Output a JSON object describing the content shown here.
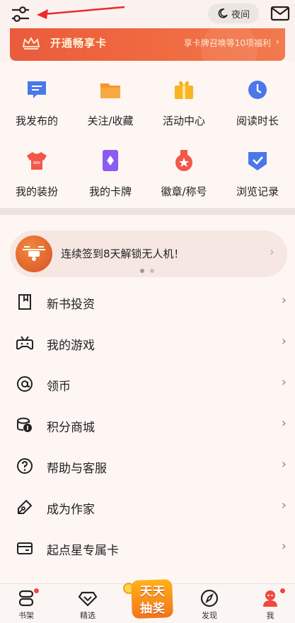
{
  "topbar": {
    "night_label": "夜间",
    "icons": {
      "filter": "sliders-icon",
      "arrow": "annotation-arrow-icon",
      "moon": "moon-icon",
      "mail": "mail-icon"
    }
  },
  "vip": {
    "title": "开通畅享卡",
    "subtitle": "享卡牌召唤等10项福利",
    "chevron": "›"
  },
  "grid": [
    {
      "label": "我发布的",
      "icon": "message-icon",
      "color": "#4a78e8"
    },
    {
      "label": "关注/收藏",
      "icon": "folder-icon",
      "color": "#f7962a"
    },
    {
      "label": "活动中心",
      "icon": "gift-icon",
      "color": "#f6b521"
    },
    {
      "label": "阅读时长",
      "icon": "clock-icon",
      "color": "#4a78e8"
    },
    {
      "label": "我的装扮",
      "icon": "tshirt-icon",
      "color": "#f2574a"
    },
    {
      "label": "我的卡牌",
      "icon": "card-icon",
      "color": "#8a5cf0"
    },
    {
      "label": "徽章/称号",
      "icon": "medal-icon",
      "color": "#f2574a"
    },
    {
      "label": "浏览记录",
      "icon": "shield-check-icon",
      "color": "#4a78e8"
    }
  ],
  "promo": {
    "text": "连续签到8天解锁无人机！",
    "chevron": "›"
  },
  "menu": [
    {
      "label": "新书投资",
      "icon": "bookmark-icon"
    },
    {
      "label": "我的游戏",
      "icon": "gamepad-icon"
    },
    {
      "label": "领币",
      "icon": "at-coin-icon"
    },
    {
      "label": "积分商城",
      "icon": "coins-icon"
    },
    {
      "label": "帮助与客服",
      "icon": "help-icon"
    },
    {
      "label": "成为作家",
      "icon": "pen-icon"
    },
    {
      "label": "起点星专属卡",
      "icon": "card-wallet-icon"
    }
  ],
  "menu_chevron": "›",
  "bottom_nav": {
    "bookshelf": "书架",
    "featured": "精选",
    "lottery_line1": "天天",
    "lottery_line2": "抽奖",
    "discover": "发现",
    "me": "我"
  },
  "colors": {
    "accent": "#f0483a",
    "vip_start": "#ea5b3c",
    "vip_end": "#f17a4e"
  }
}
